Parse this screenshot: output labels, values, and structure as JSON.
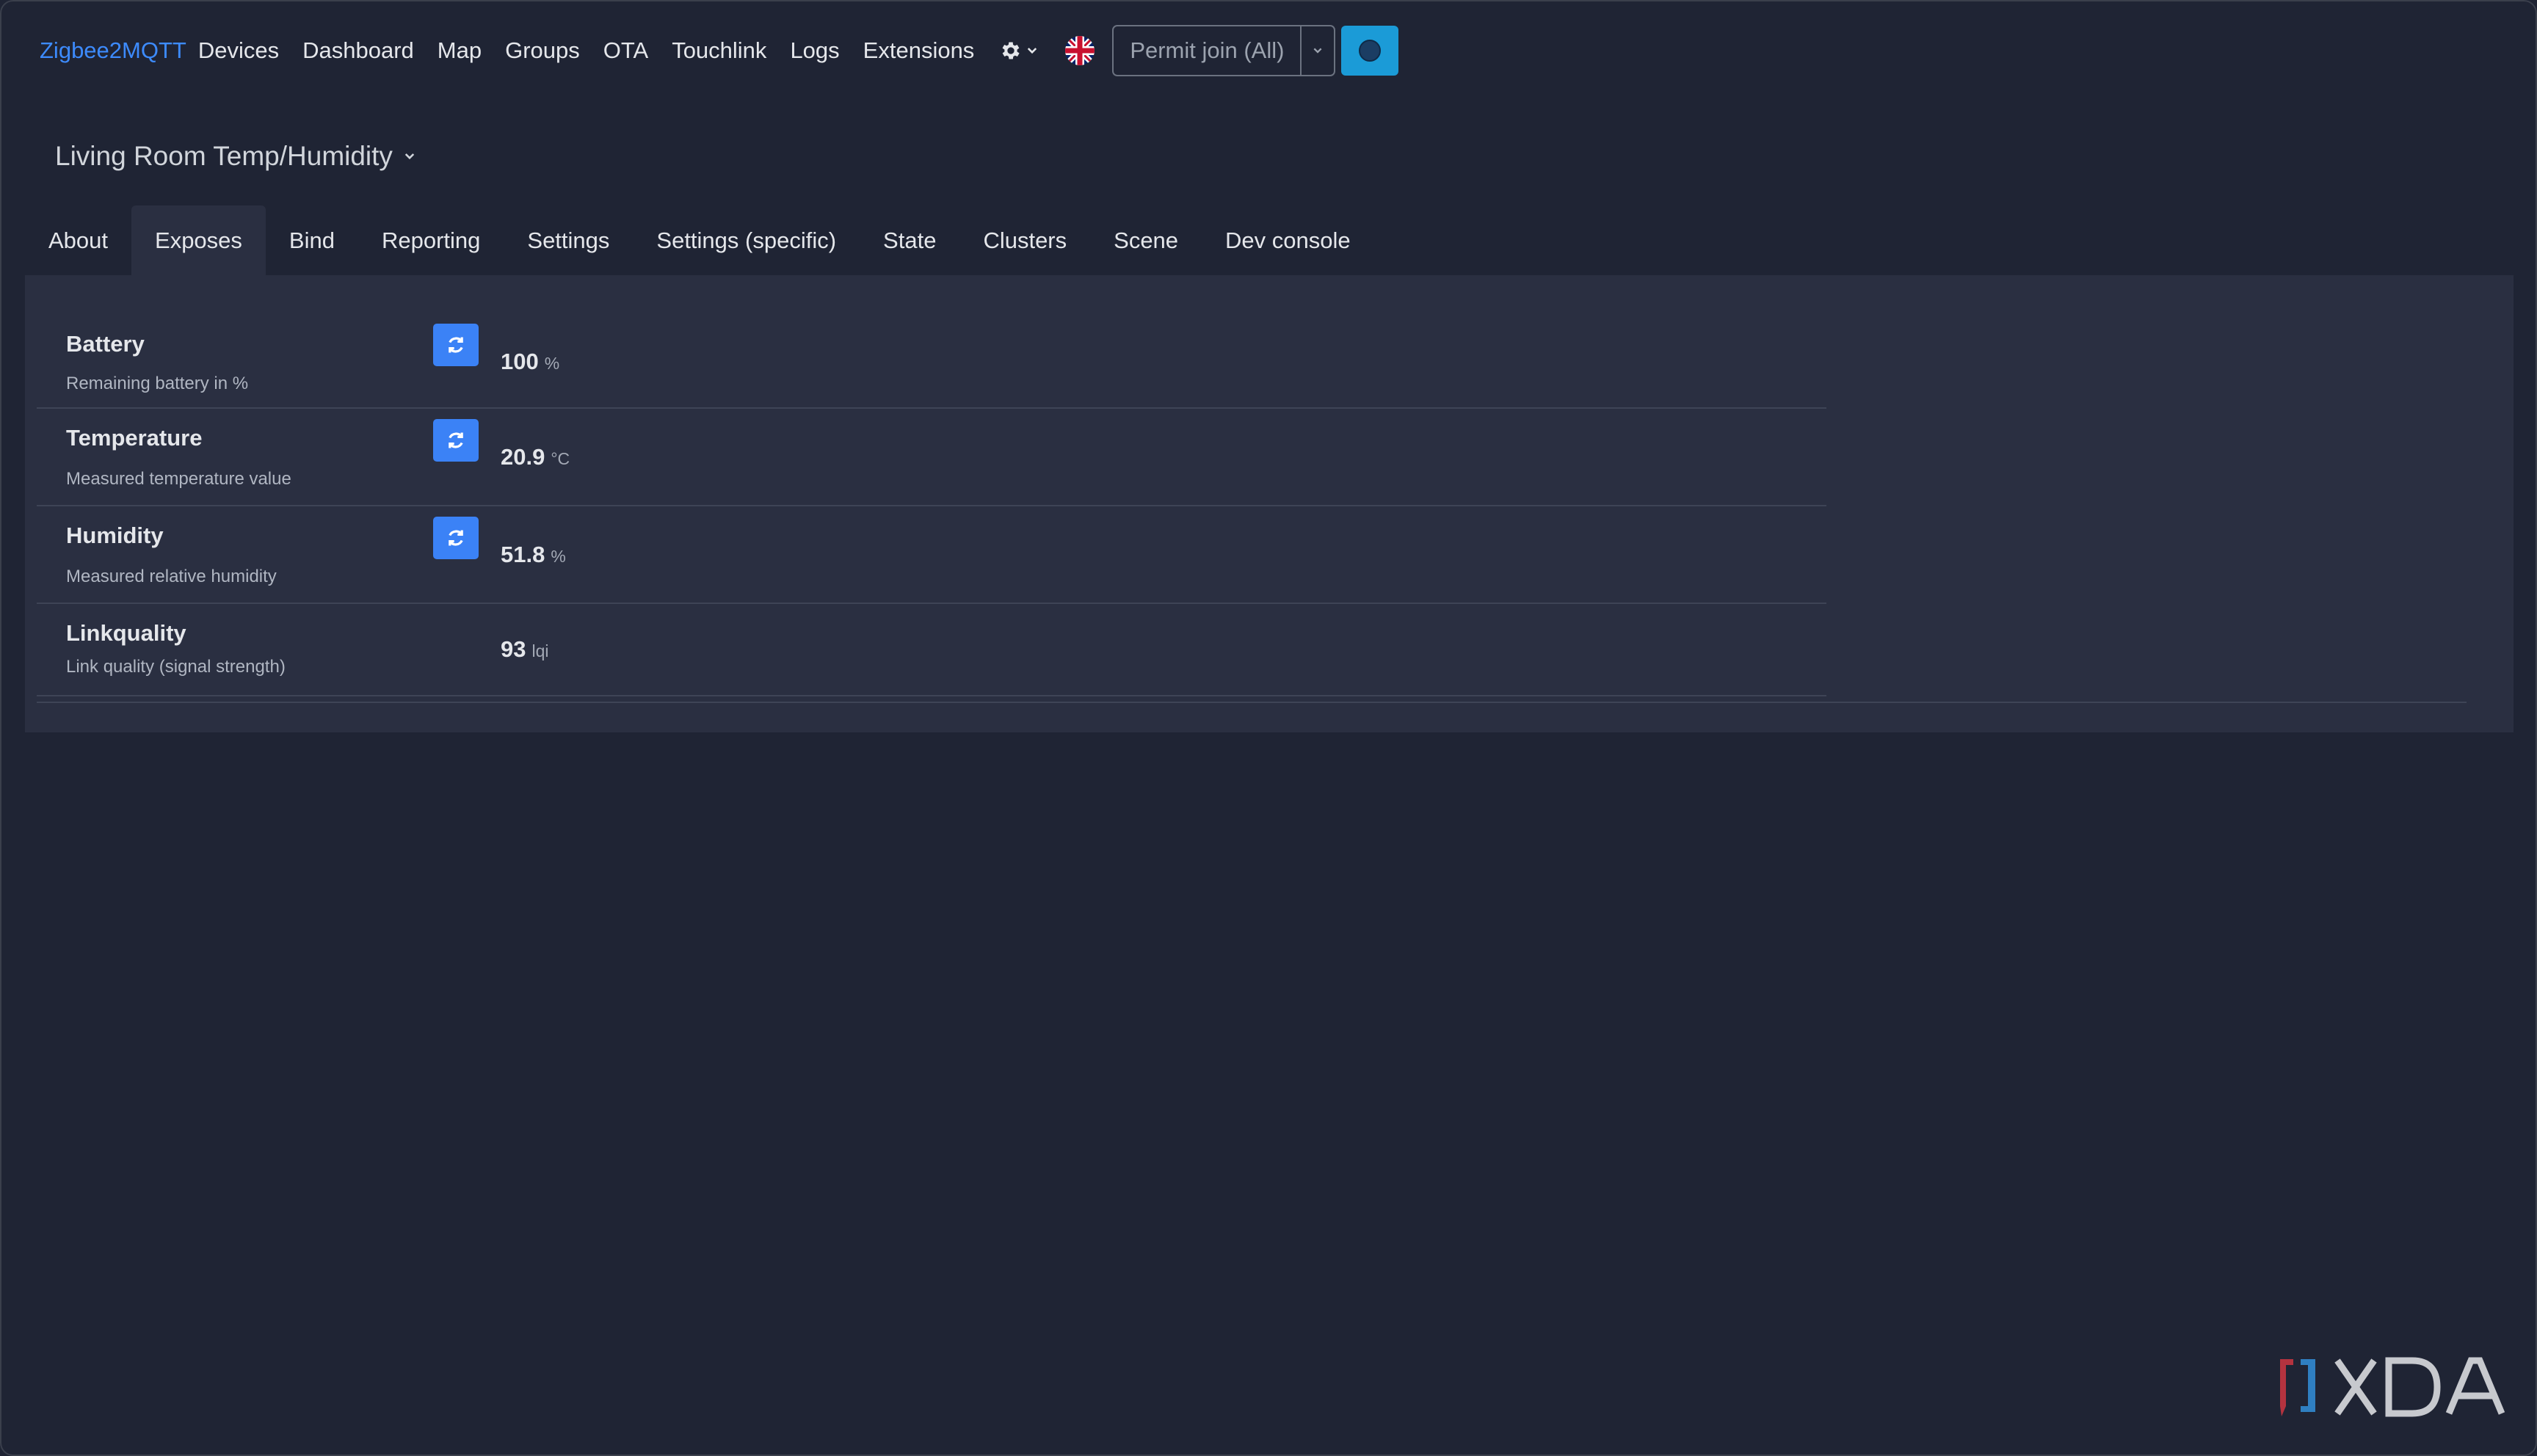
{
  "navbar": {
    "brand": "Zigbee2MQTT",
    "links": [
      "Devices",
      "Dashboard",
      "Map",
      "Groups",
      "OTA",
      "Touchlink",
      "Logs",
      "Extensions"
    ],
    "settings_icon": "gear-icon",
    "language_icon": "uk-flag-icon",
    "permit_join_label": "Permit join (All)",
    "status_color": "#1b9bd7"
  },
  "device": {
    "title": "Living Room Temp/Humidity"
  },
  "tabs": [
    "About",
    "Exposes",
    "Bind",
    "Reporting",
    "Settings",
    "Settings (specific)",
    "State",
    "Clusters",
    "Scene",
    "Dev console"
  ],
  "active_tab": "Exposes",
  "exposes": [
    {
      "label": "Battery",
      "description": "Remaining battery in %",
      "value": "100",
      "unit": "%",
      "refreshable": true
    },
    {
      "label": "Temperature",
      "description": "Measured temperature value",
      "value": "20.9",
      "unit": "°C",
      "refreshable": true
    },
    {
      "label": "Humidity",
      "description": "Measured relative humidity",
      "value": "51.8",
      "unit": "%",
      "refreshable": true
    },
    {
      "label": "Linkquality",
      "description": "Link quality (signal strength)",
      "value": "93",
      "unit": "lqi",
      "refreshable": false
    }
  ],
  "colors": {
    "background": "#1f2434",
    "panel": "#2a2f41",
    "accent": "#3b82f6",
    "brand": "#3d8bfd"
  }
}
